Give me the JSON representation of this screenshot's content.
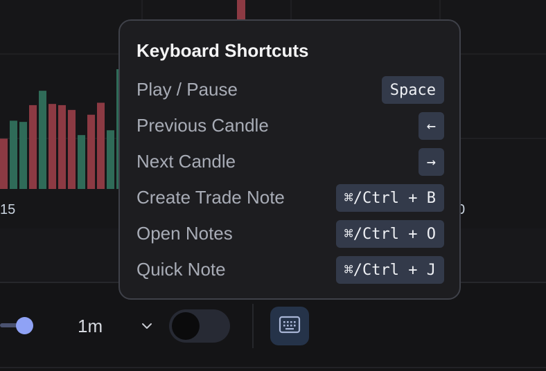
{
  "chart": {
    "x_tick_left": "15",
    "x_tick_right": "0",
    "colors": {
      "up": "#2f6b58",
      "down": "#8c3a43",
      "grid": "#222226"
    },
    "volume_bars": [
      {
        "dir": "down",
        "value": 0.42
      },
      {
        "dir": "up",
        "value": 0.57
      },
      {
        "dir": "up",
        "value": 0.56
      },
      {
        "dir": "down",
        "value": 0.7
      },
      {
        "dir": "up",
        "value": 0.82
      },
      {
        "dir": "down",
        "value": 0.71
      },
      {
        "dir": "down",
        "value": 0.7
      },
      {
        "dir": "down",
        "value": 0.66
      },
      {
        "dir": "up",
        "value": 0.45
      },
      {
        "dir": "down",
        "value": 0.62
      },
      {
        "dir": "down",
        "value": 0.72
      },
      {
        "dir": "up",
        "value": 0.49
      },
      {
        "dir": "up",
        "value": 1.0
      }
    ]
  },
  "shortcuts": {
    "title": "Keyboard Shortcuts",
    "items": [
      {
        "label": "Play / Pause",
        "key": "Space"
      },
      {
        "label": "Previous Candle",
        "key": "←"
      },
      {
        "label": "Next Candle",
        "key": "→"
      },
      {
        "label": "Create Trade Note",
        "key": "⌘/Ctrl + B"
      },
      {
        "label": "Open Notes",
        "key": "⌘/Ctrl + O"
      },
      {
        "label": "Quick Note",
        "key": "⌘/Ctrl + J"
      }
    ]
  },
  "controls": {
    "speed_slider": {
      "value": 1.0,
      "accent": "#8fa2f5"
    },
    "timeframe": {
      "value": "1m"
    },
    "toggle": {
      "on": false
    },
    "keyboard_button": {
      "icon": "keyboard-icon"
    }
  }
}
